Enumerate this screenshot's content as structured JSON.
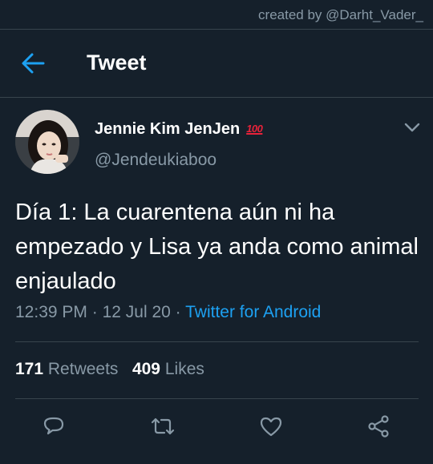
{
  "watermark": "created by @Darht_Vader_",
  "header": {
    "back_icon": "arrow-left-icon",
    "title": "Tweet"
  },
  "tweet": {
    "author_name": "Jennie Kim JenJen",
    "emoji": "100",
    "handle": "@Jendeukiaboo",
    "text": "Día 1: La cuarentena aún ni ha empezado y Lisa ya anda como animal enjaulado",
    "time": "12:39 PM",
    "date": "12 Jul 20",
    "source": "Twitter for Android",
    "separator": "·",
    "retweets_count": "171",
    "retweets_label": "Retweets",
    "likes_count": "409",
    "likes_label": "Likes"
  },
  "actions": [
    "reply-icon",
    "retweet-icon",
    "like-icon",
    "share-icon"
  ],
  "colors": {
    "background": "#15202b",
    "accent": "#1da1f2",
    "secondary_text": "#8899a6",
    "divider": "#38444d"
  }
}
